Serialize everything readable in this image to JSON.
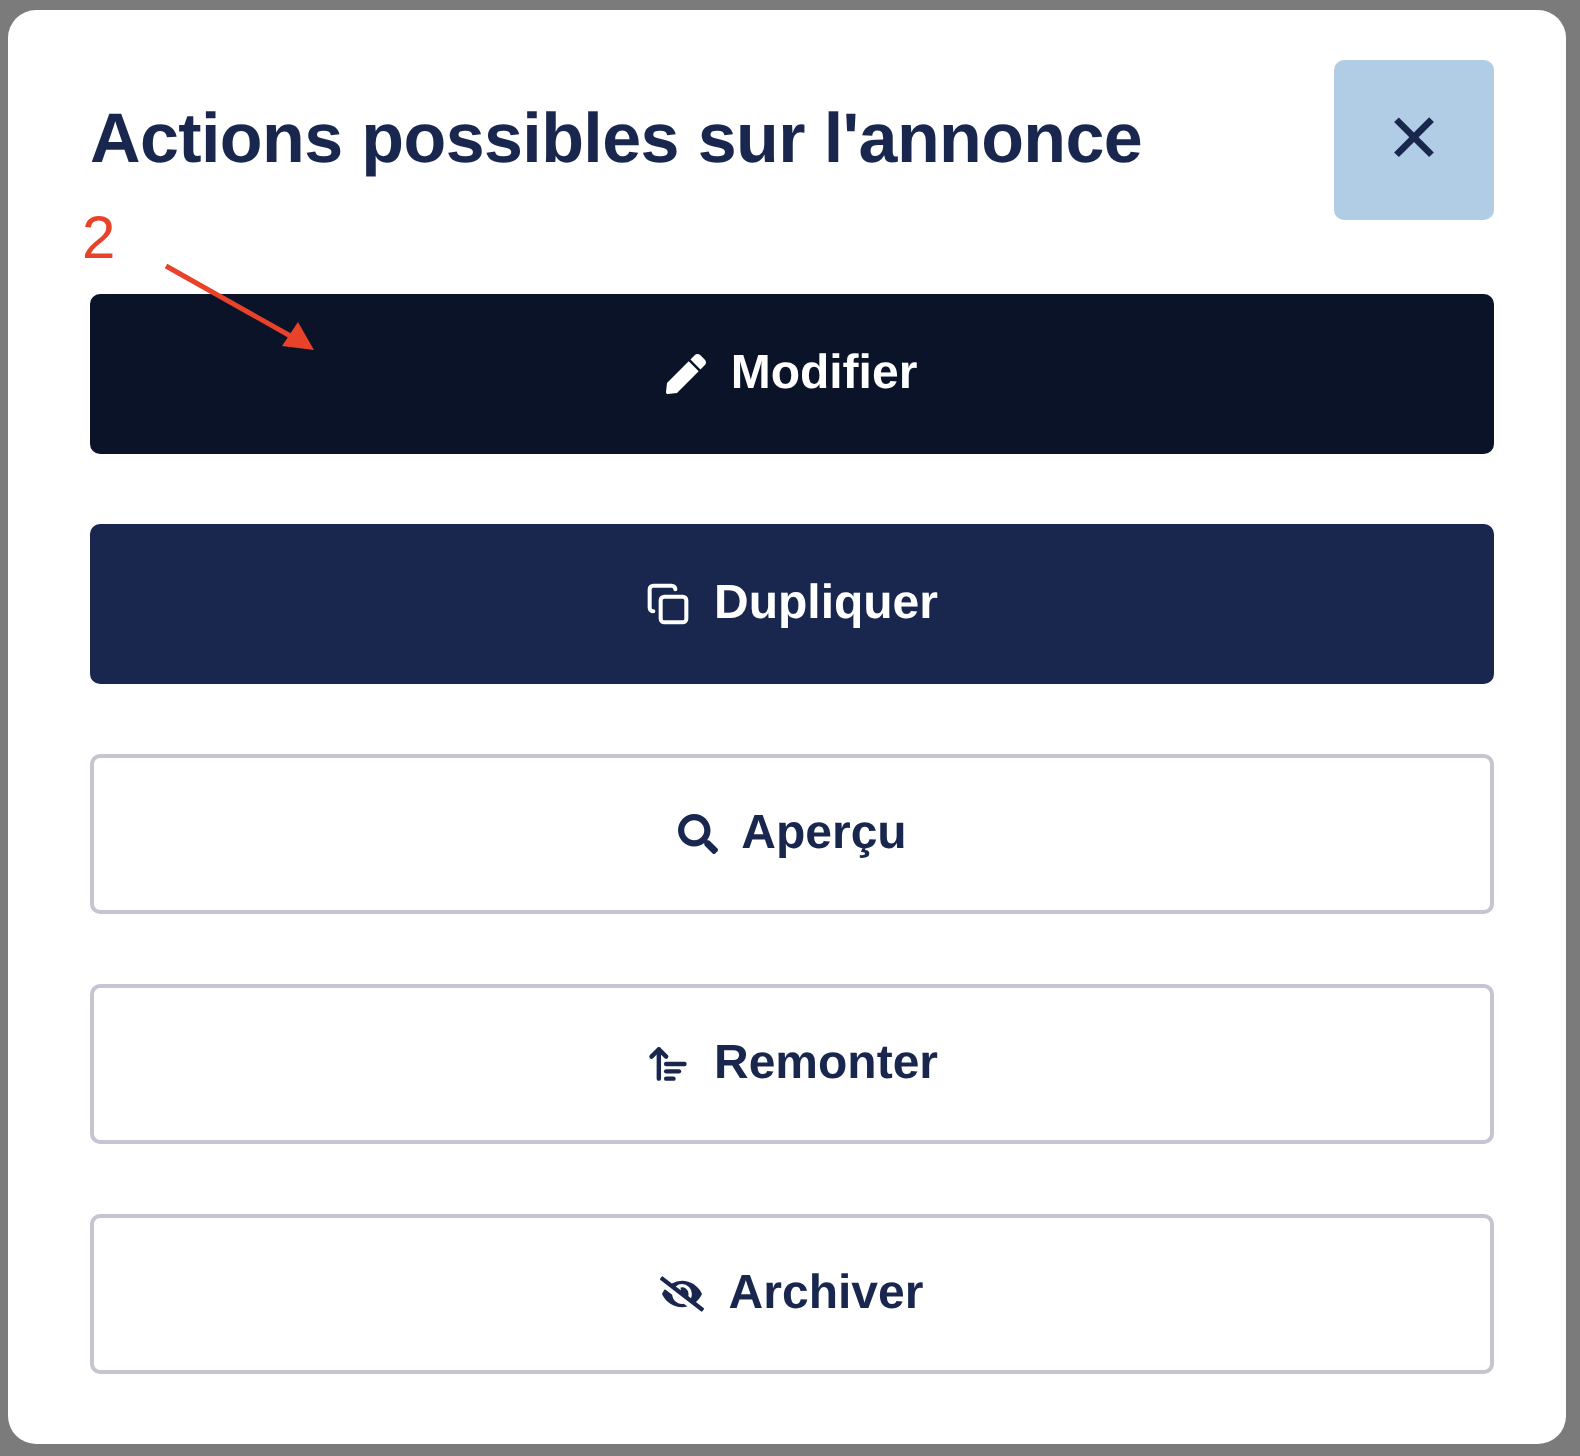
{
  "dialog": {
    "title": "Actions possibles sur l'annonce",
    "close": {
      "label": "✕"
    }
  },
  "annotation": {
    "label": "2"
  },
  "actions": [
    {
      "label": "Modifier",
      "kind": "dark"
    },
    {
      "label": "Dupliquer",
      "kind": "primary"
    },
    {
      "label": "Aperçu",
      "kind": "outline"
    },
    {
      "label": "Remonter",
      "kind": "outline"
    },
    {
      "label": "Archiver",
      "kind": "outline"
    }
  ]
}
